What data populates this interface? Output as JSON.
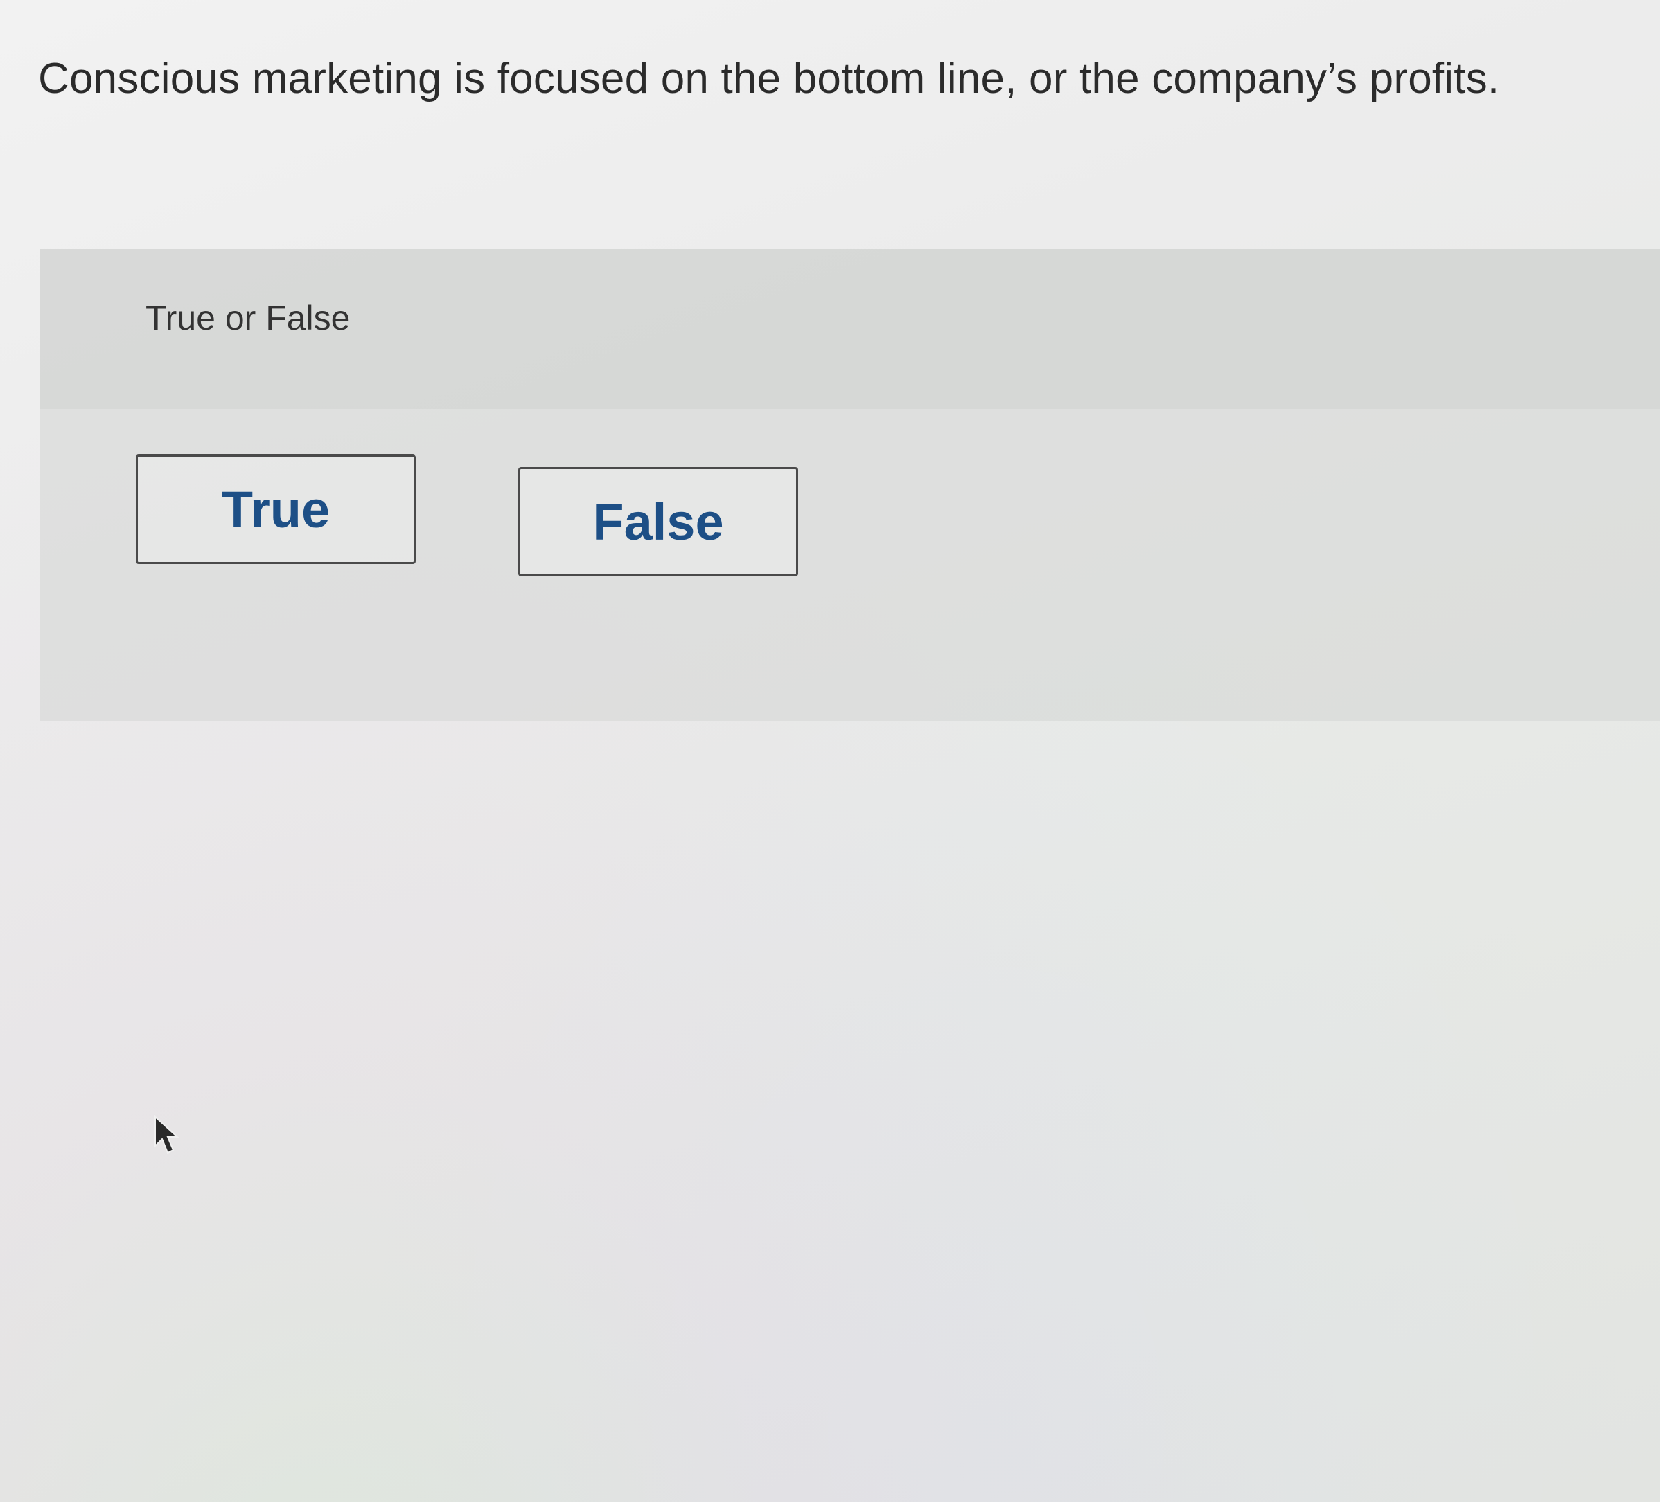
{
  "question": {
    "text": "Conscious marketing is focused on the bottom line, or the company’s profits."
  },
  "answer_panel": {
    "prompt": "True or False",
    "options": [
      {
        "label": "True"
      },
      {
        "label": "False"
      }
    ]
  },
  "colors": {
    "button_text": "#1d4f86",
    "button_border": "#4a4a4a",
    "question_text": "#2b2b2b"
  },
  "icons": {
    "cursor": "mouse-pointer-icon"
  }
}
